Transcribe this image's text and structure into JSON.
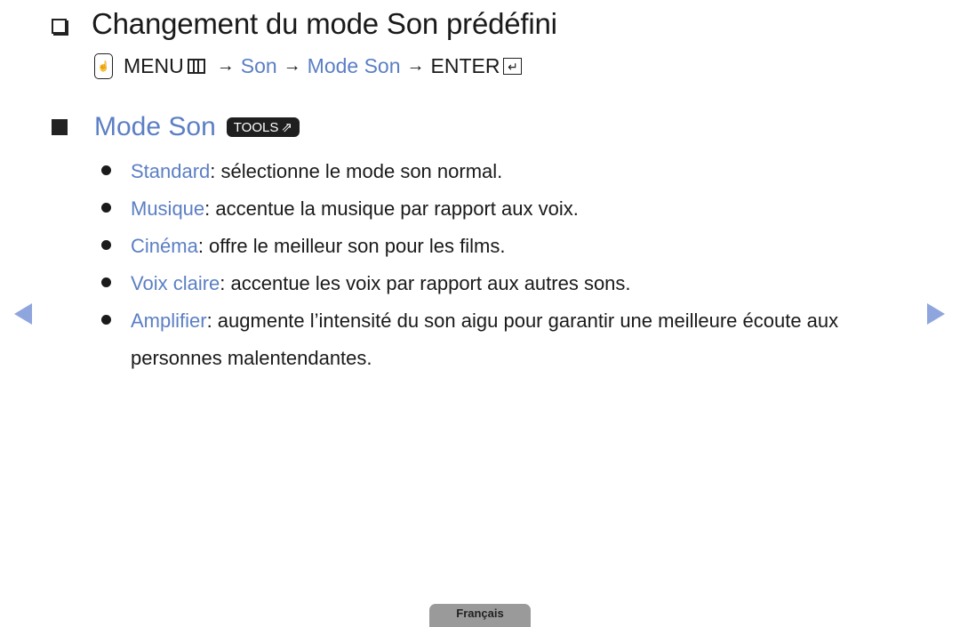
{
  "header": {
    "title": "Changement du mode Son prédéfini",
    "title_icon": "checkbox-icon"
  },
  "path": {
    "remote_icon": "remote-hand-icon",
    "menu_label": "MENU",
    "menu_icon": "menu-grid-icon",
    "arrow": "→",
    "steps": [
      "Son",
      "Mode Son"
    ],
    "enter_label": "ENTER",
    "enter_icon": "enter-icon",
    "enter_glyph": "↵"
  },
  "section": {
    "title": "Mode Son",
    "tools_label": "TOOLS",
    "tools_glyph": "⇗"
  },
  "bullets": [
    {
      "term": "Standard",
      "text": ": sélectionne le mode son normal."
    },
    {
      "term": "Musique",
      "text": ": accentue la musique par rapport aux voix."
    },
    {
      "term": "Cinéma",
      "text": ": offre le meilleur son pour les films."
    },
    {
      "term": "Voix claire",
      "text": ": accentue les voix par rapport aux autres sons."
    },
    {
      "term": "Amplifier",
      "text": ": augmente l’intensité du son aigu pour garantir une meilleure écoute aux personnes malentendantes."
    }
  ],
  "navigation": {
    "prev": "previous-page",
    "next": "next-page"
  },
  "footer": {
    "language": "Français"
  },
  "colors": {
    "accent": "#5b7fc4",
    "nav_arrow": "#8ea6dd",
    "lang_tab": "#9a9a9a"
  }
}
